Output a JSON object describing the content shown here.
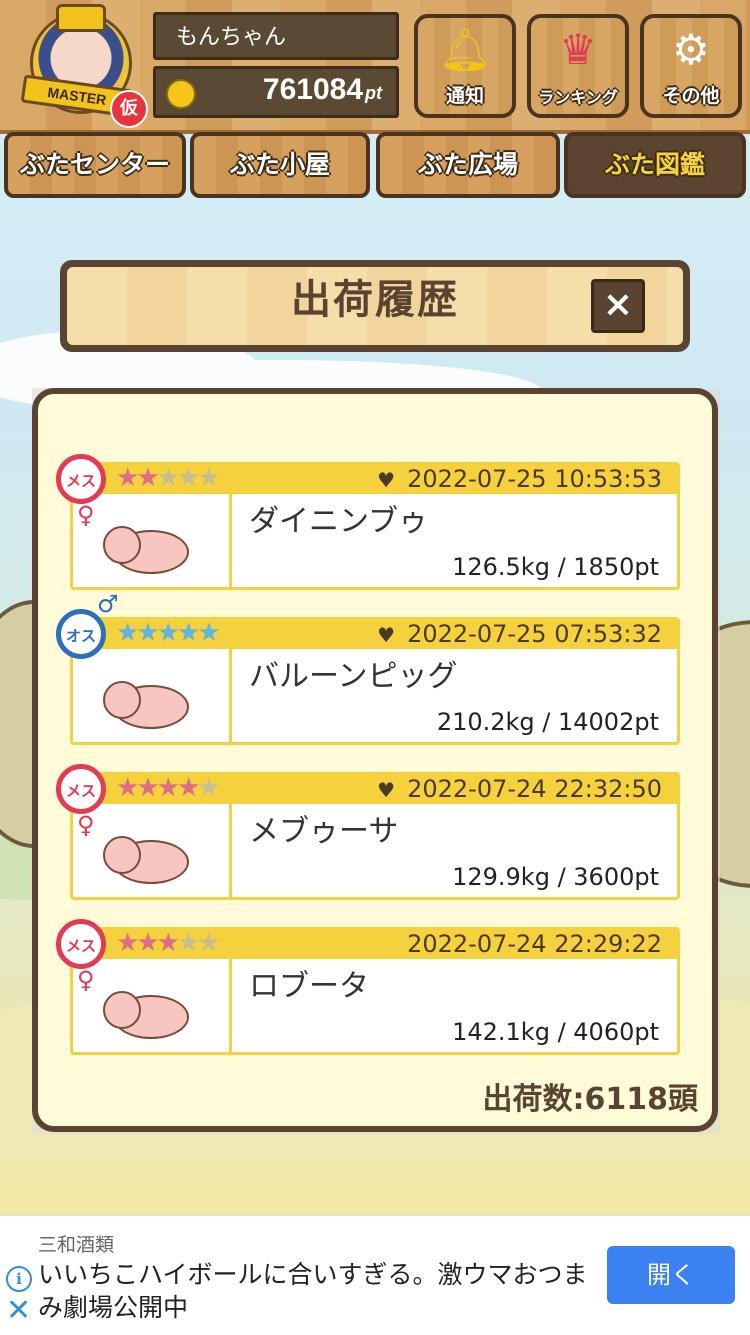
{
  "header": {
    "username": "もんちゃん",
    "points_value": "761084",
    "points_unit": "pt",
    "avatar_rank": "MASTER",
    "avatar_badge": "仮",
    "buttons": [
      {
        "label": "通知",
        "icon": "bell-icon"
      },
      {
        "label": "ランキング",
        "icon": "crown-icon"
      },
      {
        "label": "その他",
        "icon": "gear-icon"
      }
    ]
  },
  "nav": {
    "tabs": [
      {
        "label": "ぶたセンター",
        "active": false
      },
      {
        "label": "ぶた小屋",
        "active": false
      },
      {
        "label": "ぶた広場",
        "active": false
      },
      {
        "label": "ぶた図鑑",
        "active": true
      }
    ]
  },
  "dialog": {
    "title": "出荷履歴",
    "close_glyph": "×",
    "entries": [
      {
        "gender_label": "メス",
        "gender_symbol": "♀",
        "rating": 2,
        "max_rating": 5,
        "favorite": true,
        "datetime": "2022-07-25 10:53:53",
        "name": "ダイニンブゥ",
        "stats": "126.5kg / 1850pt"
      },
      {
        "gender_label": "オス",
        "gender_symbol": "♂",
        "rating": 5,
        "max_rating": 5,
        "favorite": true,
        "datetime": "2022-07-25 07:53:32",
        "name": "バルーンピッグ",
        "stats": "210.2kg / 14002pt"
      },
      {
        "gender_label": "メス",
        "gender_symbol": "♀",
        "rating": 4,
        "max_rating": 5,
        "favorite": true,
        "datetime": "2022-07-24 22:32:50",
        "name": "メブゥーサ",
        "stats": "129.9kg / 3600pt"
      },
      {
        "gender_label": "メス",
        "gender_symbol": "♀",
        "rating": 3,
        "max_rating": 5,
        "favorite": false,
        "datetime": "2022-07-24 22:29:22",
        "name": "ロブータ",
        "stats": "142.1kg / 4060pt"
      }
    ],
    "total": "出荷数:6118頭"
  },
  "ad": {
    "advertiser": "三和酒類",
    "text": "いいちこハイボールに合いすぎる。激ウマおつまみ劇場公開中",
    "button": "開く",
    "info_glyph": "i",
    "close_glyph": "✕"
  },
  "colors": {
    "wood": "#d9a766",
    "wood_dark": "#5a4330",
    "panel_bg": "#fffbd8",
    "entry_accent": "#f5d13e",
    "female": "#e23b54",
    "male": "#2b6fbd",
    "ad_button": "#3b82f0"
  }
}
